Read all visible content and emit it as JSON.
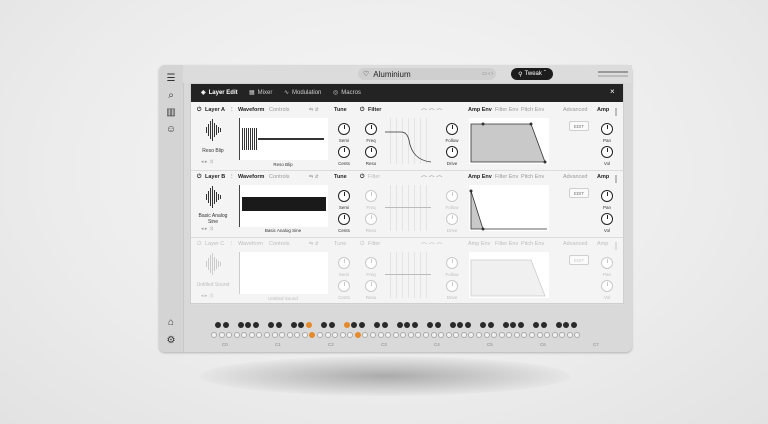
{
  "topbar": {
    "preset_name": "Aluminium",
    "tweak_label": "Tweak"
  },
  "tabs": {
    "layer_edit": "Layer Edit",
    "mixer": "Mixer",
    "modulation": "Modulation",
    "macros": "Macros"
  },
  "sections": {
    "waveform": "Waveform",
    "controls": "Controls",
    "tune": "Tune",
    "filter": "Filter",
    "amp_env": "Amp Env",
    "filter_env": "Filter Env",
    "pitch_env": "Pitch Env",
    "advanced": "Advanced",
    "amp": "Amp",
    "edit": "EDIT"
  },
  "knobs": {
    "semi": "Semi",
    "cents": "Cents",
    "freq": "Freq",
    "reso": "Reso",
    "follow": "Follow",
    "drive": "Drive",
    "pan": "Pan",
    "vol": "Vol"
  },
  "layers": [
    {
      "name": "Layer A",
      "sample": "Reso Blip",
      "wave_label": "Reso Blip"
    },
    {
      "name": "Layer B",
      "sample": "Basic Analog Sine",
      "wave_label": "Basic Analog Sine"
    },
    {
      "name": "Layer C",
      "sample": "Untitled Sound",
      "wave_label": "Untitled Sound"
    }
  ],
  "keyboard": {
    "octaves": [
      "C0",
      "C1",
      "C2",
      "C3",
      "C4",
      "C5",
      "C6",
      "C7"
    ]
  },
  "colors": {
    "accent_orange": "#e58a2a",
    "dark": "#1c1c1c"
  }
}
